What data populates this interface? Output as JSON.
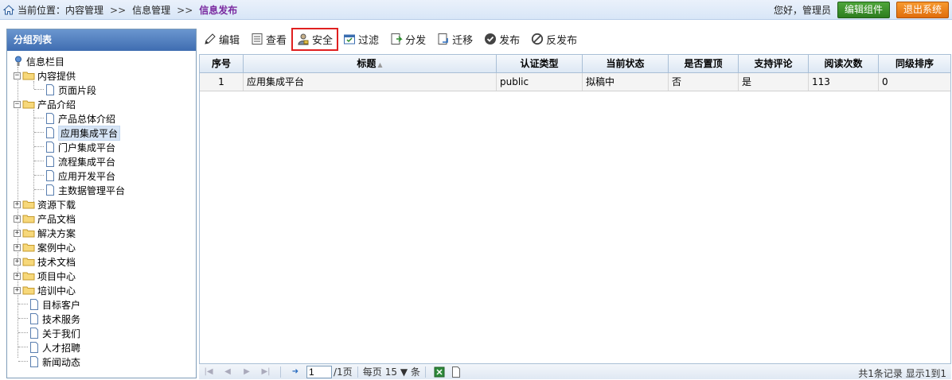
{
  "breadcrumb": {
    "prefix": "当前位置：",
    "items": [
      "内容管理",
      "信息管理"
    ],
    "separator": ">>",
    "current": "信息发布"
  },
  "header": {
    "greeting": "您好，管理员",
    "edit_component": "编辑组件",
    "logout": "退出系统"
  },
  "sidebar": {
    "title": "分组列表",
    "root": "信息栏目",
    "nodes": {
      "content": "内容提供",
      "fragment": "页面片段",
      "product": "产品介绍",
      "p1": "产品总体介绍",
      "p2": "应用集成平台",
      "p3": "门户集成平台",
      "p4": "流程集成平台",
      "p5": "应用开发平台",
      "p6": "主数据管理平台",
      "download": "资源下载",
      "docs": "产品文档",
      "solutions": "解决方案",
      "cases": "案例中心",
      "tech": "技术文档",
      "projects": "项目中心",
      "training": "培训中心",
      "customers": "目标客户",
      "services": "技术服务",
      "about": "关于我们",
      "jobs": "人才招聘",
      "news": "新闻动态"
    }
  },
  "toolbar": {
    "edit": "编辑",
    "view": "查看",
    "security": "安全",
    "filter": "过滤",
    "distribute": "分发",
    "migrate": "迁移",
    "publish": "发布",
    "unpublish": "反发布"
  },
  "table": {
    "columns": [
      "序号",
      "标题",
      "认证类型",
      "当前状态",
      "是否置顶",
      "支持评论",
      "阅读次数",
      "同级排序"
    ],
    "rows": [
      [
        "1",
        "应用集成平台",
        "public",
        "拟稿中",
        "否",
        "是",
        "113",
        "0"
      ]
    ]
  },
  "pager": {
    "page": "1",
    "total_pages": "/1页",
    "per_page_label": "每页",
    "per_page": "15",
    "unit": "条",
    "info": "共1条记录 显示1到1"
  },
  "colors": {
    "highlight_box": "#e02020",
    "header_blue": "#3f6db1",
    "edit_button": "#2d7d1f",
    "logout_button": "#e06d0c"
  }
}
